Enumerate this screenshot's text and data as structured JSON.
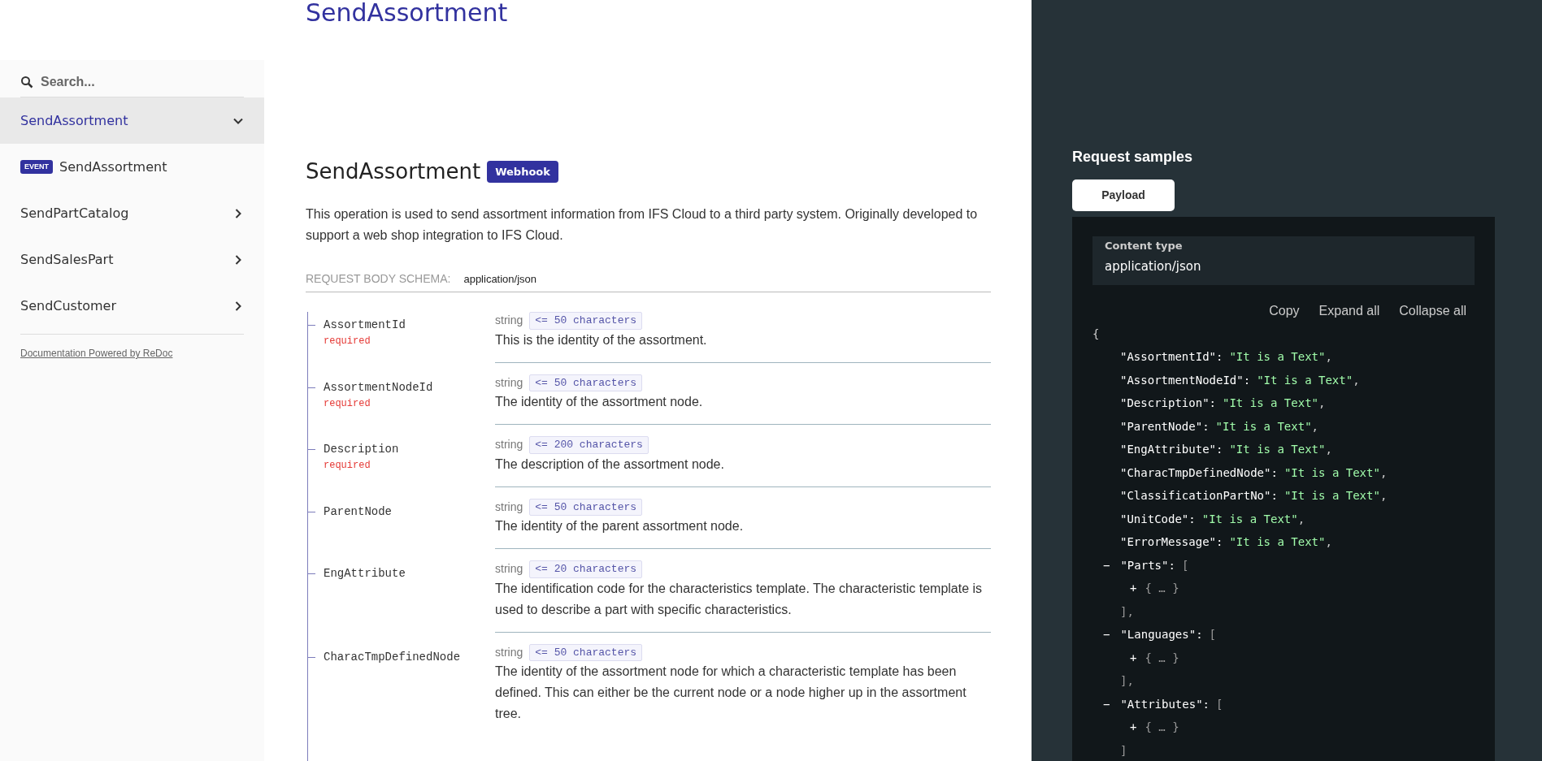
{
  "top_title": "SendAssortment",
  "sidebar": {
    "search": {
      "placeholder": "Search..."
    },
    "items": [
      {
        "label": "SendAssortment",
        "selected": true,
        "expanded": true,
        "kind": "group"
      },
      {
        "label": "SendAssortment",
        "selected": false,
        "kind": "operation",
        "badge": "EVENT"
      },
      {
        "label": "SendPartCatalog",
        "selected": false,
        "expanded": false,
        "kind": "group"
      },
      {
        "label": "SendSalesPart",
        "selected": false,
        "expanded": false,
        "kind": "group"
      },
      {
        "label": "SendCustomer",
        "selected": false,
        "expanded": false,
        "kind": "group"
      }
    ],
    "footer_link": "Documentation Powered by ReDoc"
  },
  "operation": {
    "title": "SendAssortment",
    "badge": "Webhook",
    "description": "This operation is used to send assortment information from IFS Cloud to a third party system. Originally developed to support a web shop integration to IFS Cloud.",
    "schema_label": "REQUEST BODY SCHEMA:",
    "schema_type": "application/json",
    "fields": [
      {
        "name": "AssortmentId",
        "required": "required",
        "type": "string",
        "constraint": "<= 50 characters",
        "description": "This is the identity of the assortment."
      },
      {
        "name": "AssortmentNodeId",
        "required": "required",
        "type": "string",
        "constraint": "<= 50 characters",
        "description": "The identity of the assortment node."
      },
      {
        "name": "Description",
        "required": "required",
        "type": "string",
        "constraint": "<= 200 characters",
        "description": "The description of the assortment node."
      },
      {
        "name": "ParentNode",
        "type": "string",
        "constraint": "<= 50 characters",
        "description": "The identity of the parent assortment node."
      },
      {
        "name": "EngAttribute",
        "type": "string",
        "constraint": "<= 20 characters",
        "description": "The identification code for the characteristics template. The characteristic template is used to describe a part with specific characteristics."
      },
      {
        "name": "CharacTmpDefinedNode",
        "type": "string",
        "constraint": "<= 50 characters",
        "description": "The identity of the assortment node for which a characteristic template has been defined. This can either be the current node or a node higher up in the assortment tree."
      }
    ]
  },
  "samples": {
    "title": "Request samples",
    "tabs": [
      {
        "label": "Payload",
        "selected": true
      }
    ],
    "content_type_label": "Content type",
    "content_type": "application/json",
    "actions": [
      "Copy",
      "Expand all",
      "Collapse all"
    ],
    "code": [
      {
        "kind": "punct",
        "text": "{"
      },
      {
        "kind": "prop",
        "key": "\"AssortmentId\":",
        "value": "\"It is a Text\"",
        "tail": ","
      },
      {
        "kind": "prop",
        "key": "\"AssortmentNodeId\":",
        "value": "\"It is a Text\"",
        "tail": ","
      },
      {
        "kind": "prop",
        "key": "\"Description\":",
        "value": "\"It is a Text\"",
        "tail": ","
      },
      {
        "kind": "prop",
        "key": "\"ParentNode\":",
        "value": "\"It is a Text\"",
        "tail": ","
      },
      {
        "kind": "prop",
        "key": "\"EngAttribute\":",
        "value": "\"It is a Text\"",
        "tail": ","
      },
      {
        "kind": "prop",
        "key": "\"CharacTmpDefinedNode\":",
        "value": "\"It is a Text\"",
        "tail": ","
      },
      {
        "kind": "prop",
        "key": "\"ClassificationPartNo\":",
        "value": "\"It is a Text\"",
        "tail": ","
      },
      {
        "kind": "prop",
        "key": "\"UnitCode\":",
        "value": "\"It is a Text\"",
        "tail": ","
      },
      {
        "kind": "prop",
        "key": "\"ErrorMessage\":",
        "value": "\"It is a Text\"",
        "tail": ","
      },
      {
        "kind": "array",
        "toggle": "−",
        "key": "\"Parts\":",
        "text": "["
      },
      {
        "kind": "collapsed",
        "toggle": "+",
        "text": "{ … }"
      },
      {
        "kind": "close",
        "text": "],"
      },
      {
        "kind": "array",
        "toggle": "−",
        "key": "\"Languages\":",
        "text": "["
      },
      {
        "kind": "collapsed",
        "toggle": "+",
        "text": "{ … }"
      },
      {
        "kind": "close",
        "text": "],"
      },
      {
        "kind": "array",
        "toggle": "−",
        "key": "\"Attributes\":",
        "text": "["
      },
      {
        "kind": "collapsed",
        "toggle": "+",
        "text": "{ … }"
      },
      {
        "kind": "close",
        "text": "]"
      }
    ]
  }
}
